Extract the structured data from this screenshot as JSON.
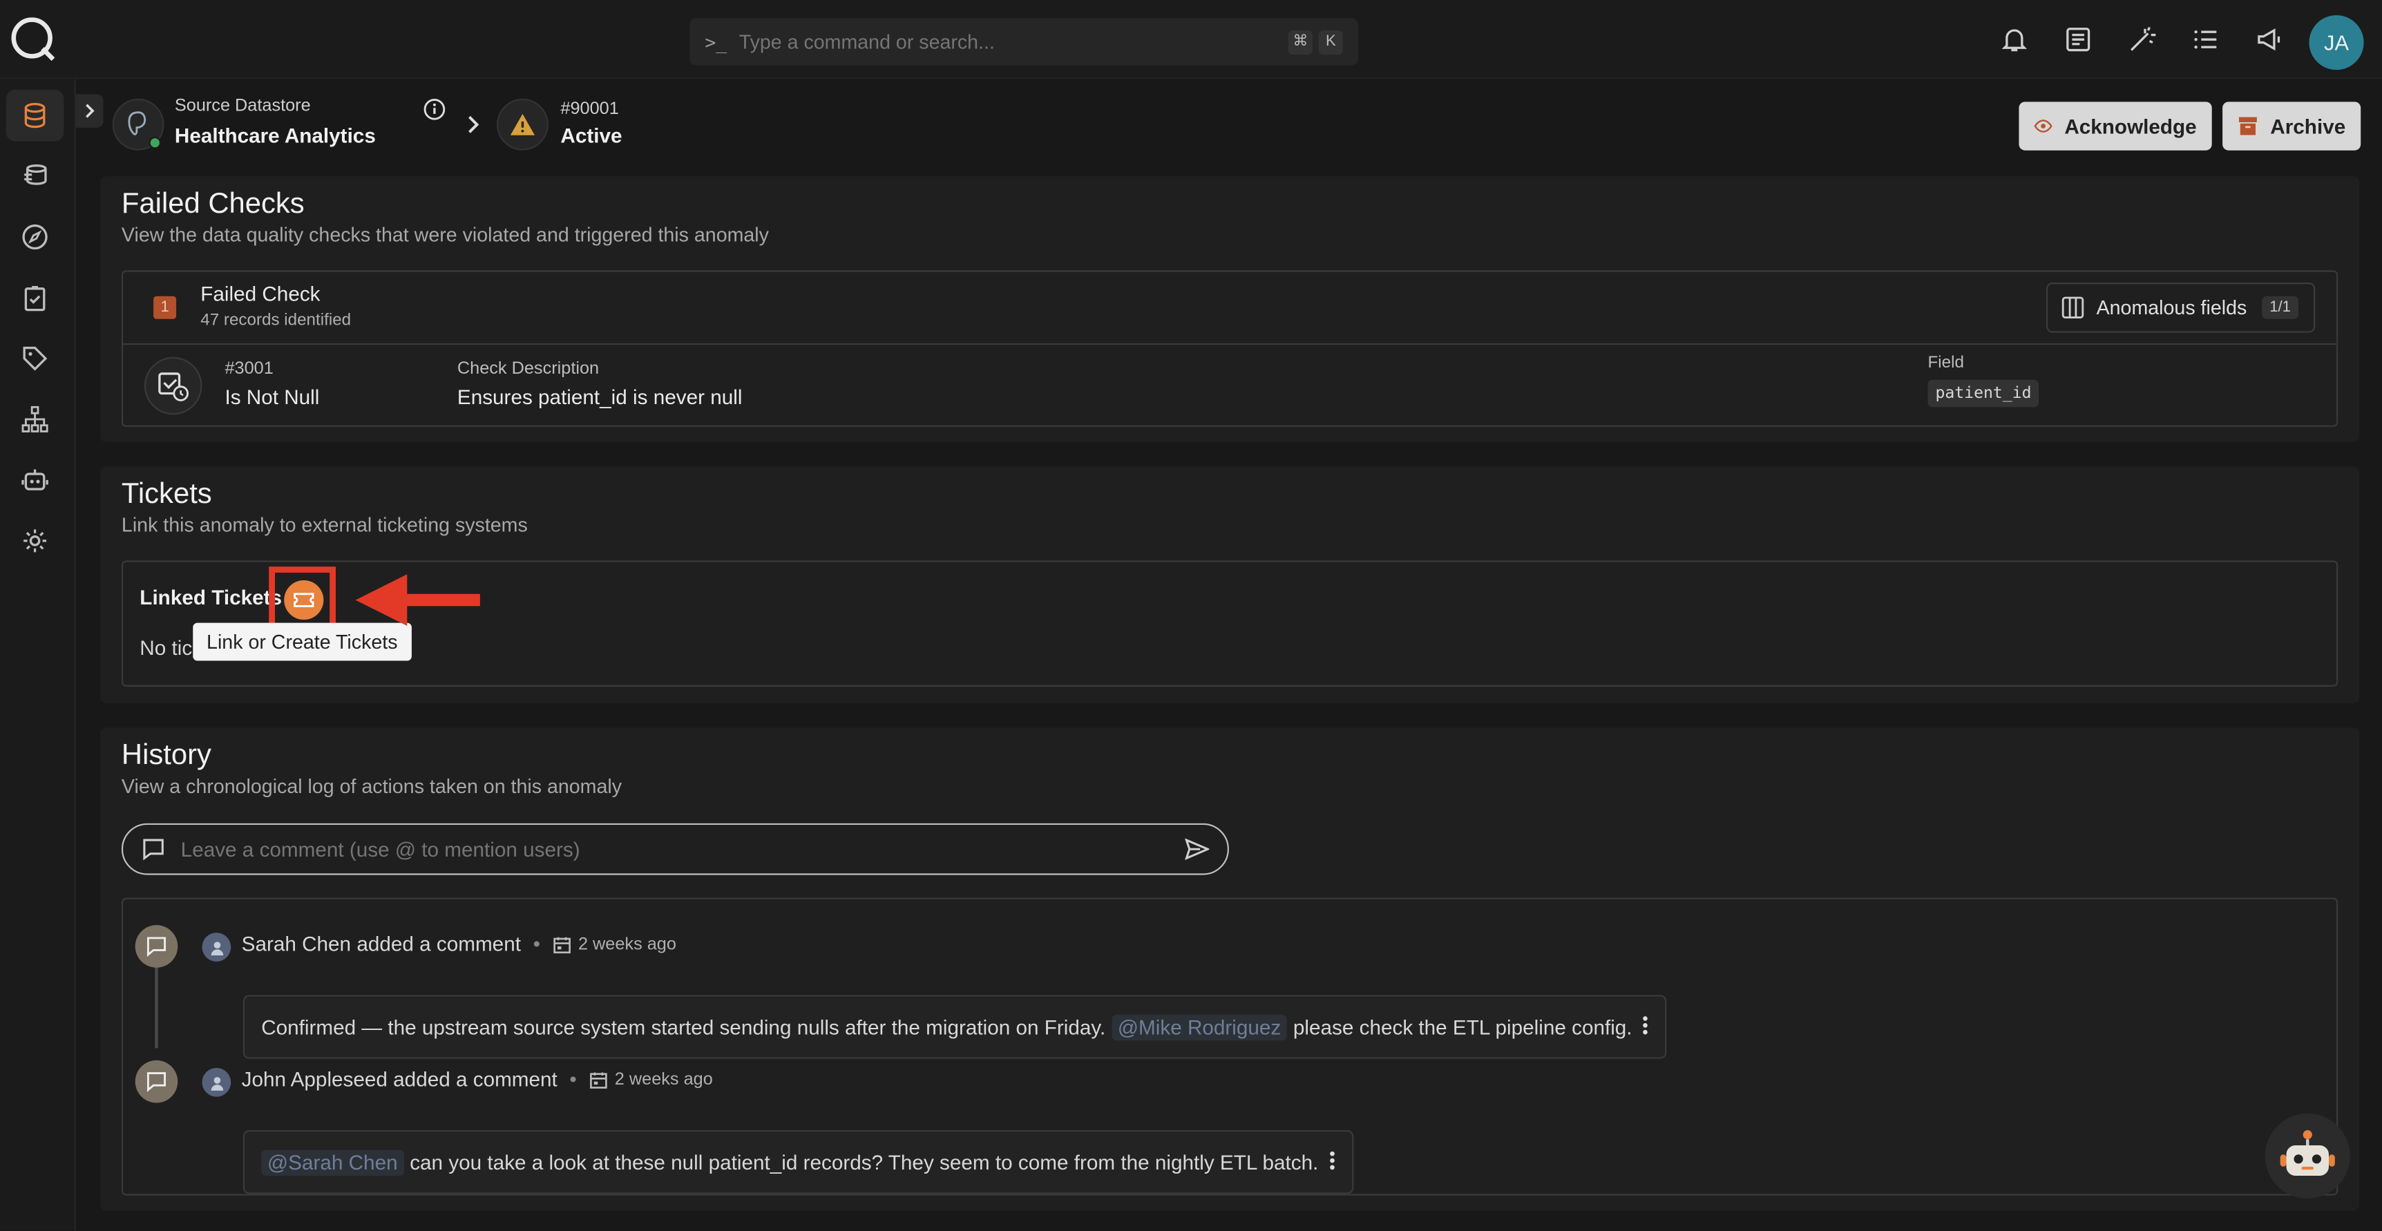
{
  "search": {
    "placeholder": "Type a command or search...",
    "shortcut_mod": "⌘",
    "shortcut_key": "K"
  },
  "user": {
    "initials": "JA"
  },
  "header": {
    "datastore_label": "Source Datastore",
    "datastore_name": "Healthcare Analytics",
    "anomaly_id": "#90001",
    "anomaly_status": "Active",
    "acknowledge_label": "Acknowledge",
    "archive_label": "Archive"
  },
  "failed_checks": {
    "title": "Failed Checks",
    "subtitle": "View the data quality checks that were violated and triggered this anomaly",
    "badge": "1",
    "check_title": "Failed Check",
    "records": "47 records identified",
    "anomalous_fields_label": "Anomalous fields",
    "anomalous_fields_count": "1/1",
    "check_id": "#3001",
    "check_name": "Is Not Null",
    "description_label": "Check Description",
    "description": "Ensures patient_id is never null",
    "field_label": "Field",
    "field_value": "patient_id"
  },
  "tickets": {
    "title": "Tickets",
    "subtitle": "Link this anomaly to external ticketing systems",
    "linked_label": "Linked Tickets",
    "empty_text": "No tic",
    "tooltip": "Link or Create Tickets"
  },
  "history": {
    "title": "History",
    "subtitle": "View a chronological log of actions taken on this anomaly",
    "comment_placeholder": "Leave a comment (use @ to mention users)",
    "entries": [
      {
        "actor": "Sarah Chen added a comment",
        "time": "2 weeks ago",
        "text_before": "Confirmed — the upstream source system started sending nulls after the migration on Friday.",
        "mention": "@Mike Rodriguez",
        "text_after": "please check the ETL pipeline config."
      },
      {
        "actor": "John Appleseed added a comment",
        "time": "2 weeks ago",
        "mention": "@Sarah Chen",
        "text_after": "can you take a look at these null patient_id records? They seem to come from the nightly ETL batch."
      }
    ]
  },
  "colors": {
    "accent": "#e8823d",
    "highlight": "#e23a27",
    "warning": "#d9a13b",
    "status_online": "#3ea55b",
    "avatar": "#2a7f92"
  },
  "icons": [
    "logo-icon",
    "terminal-icon",
    "bell-icon",
    "document-icon",
    "magic-wand-icon",
    "list-icon",
    "megaphone-icon",
    "database-icon",
    "datastores-icon",
    "compass-icon",
    "checklist-icon",
    "tag-icon",
    "hierarchy-icon",
    "robot-icon",
    "gear-icon",
    "info-icon",
    "warning-icon",
    "eye-icon",
    "archive-icon",
    "ticket-icon",
    "columns-icon",
    "comment-icon",
    "send-icon",
    "calendar-icon",
    "user-icon",
    "kebab-icon",
    "chatbot-icon"
  ]
}
